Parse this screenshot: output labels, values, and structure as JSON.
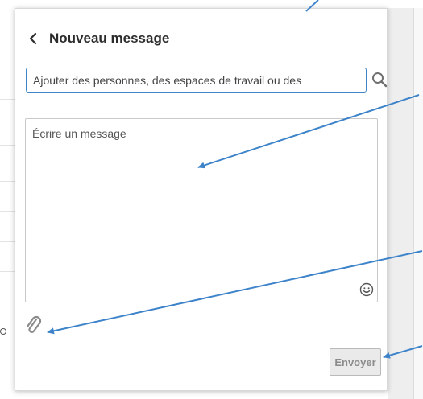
{
  "dialog": {
    "title": "Nouveau message",
    "back_icon": "chevron-left-icon"
  },
  "recipients": {
    "placeholder": "Ajouter des personnes, des espaces de travail ou des",
    "search_icon": "search-icon"
  },
  "message": {
    "placeholder": "Écrire un message",
    "emoji_icon": "smiley-icon"
  },
  "attachment": {
    "icon": "paperclip-icon"
  },
  "send": {
    "label": "Envoyer"
  },
  "colors": {
    "input_focus_border": "#3f86c8",
    "annotation_arrow": "#3d83c9",
    "send_button_bg": "#eaeaea",
    "send_button_text": "#8c8c8c"
  }
}
